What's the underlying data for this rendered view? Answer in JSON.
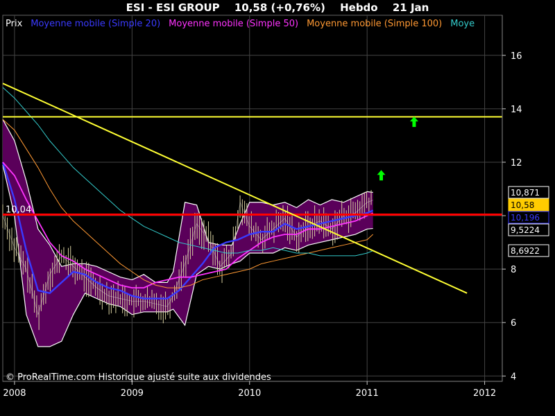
{
  "header": {
    "company": "ESI - ESI GROUP",
    "price_change": "10,58 (+0,76%)",
    "period": "Hebdo",
    "date": "21 Jan"
  },
  "legend": [
    {
      "label": "Prix",
      "color": "#ffffff"
    },
    {
      "label": "Moyenne mobile (Simple 20)",
      "color": "#3a3aff"
    },
    {
      "label": "Moyenne mobile (Simple 50)",
      "color": "#ff33ff"
    },
    {
      "label": "Moyenne mobile (Simple 100)",
      "color": "#ff9933"
    },
    {
      "label": "Moye",
      "color": "#33cccc"
    }
  ],
  "copyright": "© ProRealTime.com Historique ajusté suite aux dividendes",
  "price_labels": {
    "left_level": "10,04",
    "boxes": [
      {
        "text": "10,871",
        "value": 10.871,
        "bg": "#000000",
        "fg": "#ffffff",
        "border": "#ffffff"
      },
      {
        "text": "10,58",
        "value": 10.58,
        "bg": "#ffcc00",
        "fg": "#000000",
        "border": "#ffcc00"
      },
      {
        "text": "10,196",
        "value": 10.196,
        "bg": "#000000",
        "fg": "#3a3aff",
        "border": "#3a3aff"
      },
      {
        "text": "9,5224",
        "value": 9.5224,
        "bg": "#000000",
        "fg": "#ffffff",
        "border": "#ffffff"
      },
      {
        "text": "8,6922",
        "value": 8.6922,
        "bg": "#000000",
        "fg": "#ffffff",
        "border": "#ffffff"
      }
    ]
  },
  "colors": {
    "background": "#000000",
    "band_fill": "#5a005a",
    "grid": "#444444",
    "support_line": "#ff0000",
    "trend_line": "#ffff33",
    "resistance_line": "#ffff33",
    "arrow": "#00ff00"
  },
  "chart_data": {
    "type": "line",
    "title": "ESI - ESI GROUP",
    "x_range": [
      2007.9,
      2012.15
    ],
    "ylim": [
      3.8,
      17.5
    ],
    "x_ticks": [
      2008,
      2009,
      2010,
      2011,
      2012
    ],
    "x_tick_labels": [
      "2008",
      "2009",
      "2010",
      "2011",
      "2012"
    ],
    "y_ticks": [
      4,
      6,
      8,
      10,
      12,
      14,
      16
    ],
    "y_tick_labels": [
      "4",
      "6",
      "8",
      "10",
      "12",
      "14",
      "16"
    ],
    "grid": true,
    "horizontal_lines": [
      {
        "name": "support",
        "y": 10.04,
        "color": "#ff0000"
      },
      {
        "name": "resistance",
        "y": 13.7,
        "color": "#ffff33"
      }
    ],
    "trend_line": {
      "x": [
        2007.9,
        2011.85
      ],
      "y": [
        14.95,
        7.1
      ]
    },
    "arrows": [
      {
        "x": 2011.12,
        "y": 11.5
      },
      {
        "x": 2011.4,
        "y": 13.5
      }
    ],
    "price": {
      "x": [
        2007.9,
        2008.0,
        2008.1,
        2008.2,
        2008.3,
        2008.4,
        2008.5,
        2008.6,
        2008.7,
        2008.8,
        2008.9,
        2009.0,
        2009.1,
        2009.2,
        2009.3,
        2009.35,
        2009.45,
        2009.55,
        2009.65,
        2009.75,
        2009.85,
        2009.92,
        2010.0,
        2010.1,
        2010.2,
        2010.3,
        2010.4,
        2010.5,
        2010.6,
        2010.7,
        2010.8,
        2010.9,
        2011.0,
        2011.05
      ],
      "y": [
        10.0,
        8.8,
        8.0,
        6.3,
        7.8,
        8.5,
        8.1,
        7.7,
        7.3,
        7.0,
        6.9,
        6.8,
        6.8,
        6.7,
        6.6,
        7.0,
        8.2,
        9.7,
        9.1,
        8.1,
        8.6,
        10.5,
        9.6,
        9.1,
        9.5,
        9.9,
        9.2,
        9.6,
        9.8,
        9.5,
        10.0,
        10.1,
        10.5,
        10.58
      ]
    },
    "bollinger_upper": {
      "x": [
        2007.9,
        2008.0,
        2008.1,
        2008.2,
        2008.3,
        2008.4,
        2008.5,
        2008.6,
        2008.7,
        2008.8,
        2008.9,
        2009.0,
        2009.1,
        2009.2,
        2009.3,
        2009.35,
        2009.45,
        2009.55,
        2009.65,
        2009.75,
        2009.85,
        2009.92,
        2010.0,
        2010.1,
        2010.2,
        2010.3,
        2010.4,
        2010.5,
        2010.6,
        2010.7,
        2010.8,
        2010.9,
        2011.0,
        2011.05
      ],
      "y": [
        13.6,
        12.8,
        11.3,
        9.5,
        8.9,
        8.1,
        8.2,
        8.2,
        8.1,
        7.9,
        7.7,
        7.6,
        7.8,
        7.5,
        7.5,
        7.9,
        10.5,
        10.4,
        9.0,
        8.9,
        8.9,
        9.7,
        10.5,
        10.5,
        10.4,
        10.5,
        10.3,
        10.6,
        10.4,
        10.6,
        10.5,
        10.7,
        10.9,
        10.87
      ]
    },
    "bollinger_lower": {
      "x": [
        2007.9,
        2008.0,
        2008.1,
        2008.2,
        2008.3,
        2008.4,
        2008.5,
        2008.6,
        2008.7,
        2008.8,
        2008.9,
        2009.0,
        2009.1,
        2009.2,
        2009.3,
        2009.35,
        2009.45,
        2009.55,
        2009.65,
        2009.75,
        2009.85,
        2009.92,
        2010.0,
        2010.1,
        2010.2,
        2010.3,
        2010.4,
        2010.5,
        2010.6,
        2010.7,
        2010.8,
        2010.9,
        2011.0,
        2011.05
      ],
      "y": [
        11.9,
        10.0,
        6.3,
        5.1,
        5.1,
        5.3,
        6.3,
        7.1,
        6.9,
        6.7,
        6.6,
        6.3,
        6.4,
        6.4,
        6.4,
        6.5,
        5.9,
        7.8,
        8.1,
        8.0,
        8.2,
        8.3,
        8.6,
        8.6,
        8.6,
        8.8,
        8.7,
        8.9,
        9.0,
        9.1,
        9.2,
        9.3,
        9.5,
        9.52
      ]
    },
    "series": [
      {
        "name": "Moyenne mobile (Simple 20)",
        "color": "#3a3aff",
        "x": [
          2007.9,
          2008.0,
          2008.1,
          2008.2,
          2008.3,
          2008.4,
          2008.5,
          2008.6,
          2008.7,
          2008.8,
          2008.9,
          2009.0,
          2009.1,
          2009.2,
          2009.3,
          2009.4,
          2009.5,
          2009.6,
          2009.7,
          2009.8,
          2009.9,
          2010.0,
          2010.1,
          2010.2,
          2010.3,
          2010.4,
          2010.5,
          2010.6,
          2010.7,
          2010.8,
          2010.9,
          2011.0,
          2011.05
        ],
        "y": [
          12.0,
          10.6,
          8.7,
          7.2,
          7.1,
          7.5,
          7.9,
          7.8,
          7.5,
          7.3,
          7.2,
          7.0,
          6.9,
          6.9,
          6.9,
          7.2,
          7.7,
          8.2,
          8.8,
          9.0,
          9.1,
          9.3,
          9.4,
          9.4,
          9.7,
          9.5,
          9.6,
          9.7,
          9.8,
          9.9,
          10.0,
          10.1,
          10.196
        ]
      },
      {
        "name": "Moyenne mobile (Simple 50)",
        "color": "#ff33ff",
        "x": [
          2007.9,
          2008.0,
          2008.1,
          2008.2,
          2008.3,
          2008.4,
          2008.5,
          2008.6,
          2008.7,
          2008.8,
          2008.9,
          2009.0,
          2009.1,
          2009.2,
          2009.3,
          2009.4,
          2009.5,
          2009.6,
          2009.7,
          2009.8,
          2009.9,
          2010.0,
          2010.1,
          2010.2,
          2010.3,
          2010.4,
          2010.5,
          2010.6,
          2010.7,
          2010.8,
          2010.9,
          2011.0,
          2011.05
        ],
        "y": [
          12.0,
          11.5,
          10.6,
          9.8,
          9.0,
          8.5,
          8.3,
          8.0,
          7.8,
          7.6,
          7.4,
          7.3,
          7.3,
          7.5,
          7.6,
          7.7,
          7.7,
          7.8,
          7.9,
          8.0,
          8.4,
          8.7,
          9.0,
          9.2,
          9.3,
          9.3,
          9.5,
          9.5,
          9.6,
          9.7,
          9.8,
          10.0,
          10.1
        ]
      },
      {
        "name": "Moyenne mobile (Simple 100)",
        "color": "#ff9933",
        "x": [
          2007.9,
          2008.0,
          2008.1,
          2008.2,
          2008.3,
          2008.4,
          2008.5,
          2008.6,
          2008.7,
          2008.8,
          2008.9,
          2009.0,
          2009.1,
          2009.2,
          2009.3,
          2009.4,
          2009.5,
          2009.6,
          2009.7,
          2009.8,
          2009.9,
          2010.0,
          2010.1,
          2010.2,
          2010.3,
          2010.4,
          2010.5,
          2010.6,
          2010.7,
          2010.8,
          2010.9,
          2011.0,
          2011.05
        ],
        "y": [
          13.6,
          13.2,
          12.5,
          11.8,
          11.0,
          10.3,
          9.8,
          9.4,
          9.0,
          8.6,
          8.2,
          7.9,
          7.6,
          7.4,
          7.3,
          7.3,
          7.4,
          7.6,
          7.7,
          7.8,
          7.9,
          8.0,
          8.2,
          8.3,
          8.4,
          8.5,
          8.6,
          8.7,
          8.8,
          8.9,
          9.0,
          9.1,
          9.3
        ]
      },
      {
        "name": "Moye",
        "color": "#33cccc",
        "x": [
          2007.9,
          2008.0,
          2008.1,
          2008.2,
          2008.3,
          2008.4,
          2008.5,
          2008.6,
          2008.7,
          2008.8,
          2008.9,
          2009.0,
          2009.1,
          2009.2,
          2009.3,
          2009.4,
          2009.5,
          2009.6,
          2009.7,
          2009.8,
          2009.9,
          2010.0,
          2010.1,
          2010.2,
          2010.3,
          2010.4,
          2010.5,
          2010.6,
          2010.7,
          2010.8,
          2010.9,
          2011.0,
          2011.05
        ],
        "y": [
          14.8,
          14.4,
          13.9,
          13.4,
          12.8,
          12.3,
          11.8,
          11.4,
          11.0,
          10.6,
          10.2,
          9.9,
          9.6,
          9.4,
          9.2,
          9.0,
          8.9,
          8.8,
          8.7,
          8.6,
          8.6,
          8.7,
          8.7,
          8.8,
          8.7,
          8.6,
          8.6,
          8.5,
          8.5,
          8.5,
          8.5,
          8.6,
          8.69
        ]
      }
    ]
  }
}
